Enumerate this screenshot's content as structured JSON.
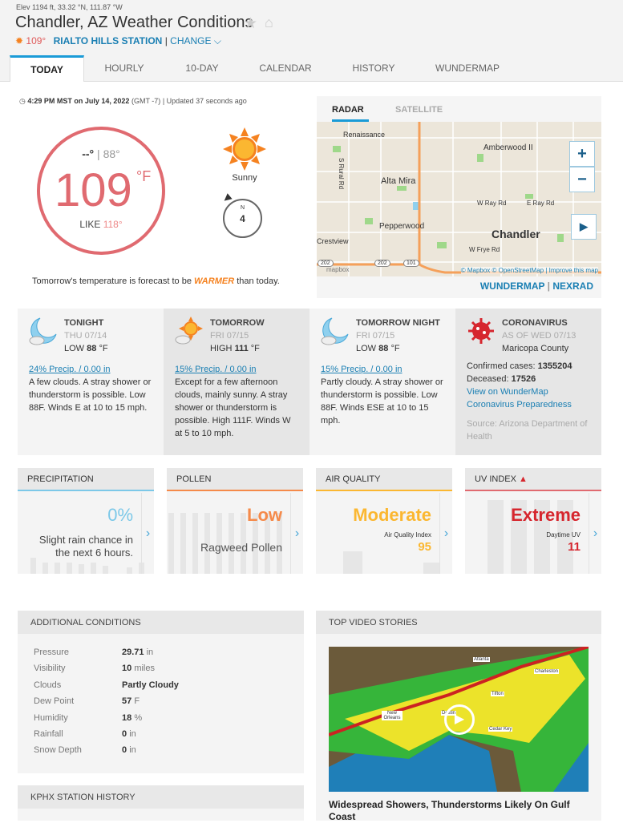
{
  "header": {
    "elevation": "Elev 1194 ft, 33.32 °N, 111.87 °W",
    "title": "Chandler, AZ Weather Conditions",
    "station_temp": "109°",
    "station_name": "RIALTO HILLS STATION",
    "separator": "|",
    "change": "CHANGE"
  },
  "tabs": [
    "TODAY",
    "HOURLY",
    "10-DAY",
    "CALENDAR",
    "HISTORY",
    "WUNDERMAP"
  ],
  "current": {
    "time": "4:29 PM MST on July 14, 2022",
    "tz": "(GMT -7)",
    "updated": "| Updated 37 seconds ago",
    "high": "--°",
    "low": "88°",
    "temp": "109",
    "unit": "°F",
    "like_label": "LIKE",
    "like": "118°",
    "condition": "Sunny",
    "wind_dir": "N",
    "wind_speed": "4",
    "tomorrow_pre": "Tomorrow's temperature is forecast to be",
    "tomorrow_word": "WARMER",
    "tomorrow_post": "than today."
  },
  "map": {
    "tabs": [
      "RADAR",
      "SATELLITE"
    ],
    "labels": [
      "Renaissance",
      "Amberwood II",
      "S Rural Rd",
      "Alta Mira",
      "W Ray Rd",
      "E Ray Rd",
      "Pepperwood",
      "Chandler",
      "Crestview",
      "W Frye Rd",
      "202",
      "202",
      "101"
    ],
    "attribution": "© Mapbox © OpenStreetMap | Improve this map",
    "logo": "mapbox",
    "links": {
      "wundermap": "WUNDERMAP",
      "sep": "|",
      "nexrad": "NEXRAD"
    }
  },
  "forecast": [
    {
      "title": "TONIGHT",
      "date": "THU 07/14",
      "temp_label": "LOW",
      "temp": "88",
      "unit": "°F",
      "precip": "24% Precip. / 0.00 in",
      "text": "A few clouds. A stray shower or thunderstorm is possible. Low 88F. Winds E at 10 to 15 mph.",
      "icon": "moon-cloud-icon"
    },
    {
      "title": "TOMORROW",
      "date": "FRI 07/15",
      "temp_label": "HIGH",
      "temp": "111",
      "unit": "°F",
      "precip": "15% Precip. / 0.00 in",
      "text": "Except for a few afternoon clouds, mainly sunny. A stray shower or thunderstorm is possible. High 111F. Winds W at 5 to 10 mph.",
      "icon": "sun-cloud-icon"
    },
    {
      "title": "TOMORROW NIGHT",
      "date": "FRI 07/15",
      "temp_label": "LOW",
      "temp": "88",
      "unit": "°F",
      "precip": "15% Precip. / 0.00 in",
      "text": "Partly cloudy. A stray shower or thunderstorm is possible. Low 88F. Winds ESE at 10 to 15 mph.",
      "icon": "moon-cloud-icon"
    }
  ],
  "covid": {
    "title": "CORONAVIRUS",
    "date": "AS OF WED 07/13",
    "county": "Maricopa County",
    "cases_label": "Confirmed cases:",
    "cases": "1355204",
    "deceased_label": "Deceased:",
    "deceased": "17526",
    "link1": "View on WunderMap",
    "link2": "Coronavirus Preparedness",
    "source": "Source: Arizona Department of Health"
  },
  "tiles": [
    {
      "title": "PRECIPITATION",
      "value": "0%",
      "desc": "Slight rain chance in the next 6 hours.",
      "color": "#7cc8e8"
    },
    {
      "title": "POLLEN",
      "value": "Low",
      "desc": "Ragweed Pollen",
      "color": "#f58a4a"
    },
    {
      "title": "AIR QUALITY",
      "value": "Moderate",
      "sub": "Air Quality Index",
      "num": "95",
      "color": "#fbb731"
    },
    {
      "title": "UV INDEX",
      "warn": "▲",
      "value": "Extreme",
      "sub": "Daytime UV",
      "num": "11",
      "color": "#e02b35"
    }
  ],
  "additional": {
    "title": "ADDITIONAL CONDITIONS",
    "rows": [
      {
        "label": "Pressure",
        "value": "29.71",
        "unit": "in"
      },
      {
        "label": "Visibility",
        "value": "10",
        "unit": "miles"
      },
      {
        "label": "Clouds",
        "value": "Partly Cloudy",
        "unit": ""
      },
      {
        "label": "Dew Point",
        "value": "57",
        "unit": "F"
      },
      {
        "label": "Humidity",
        "value": "18",
        "unit": "%"
      },
      {
        "label": "Rainfall",
        "value": "0",
        "unit": "in"
      },
      {
        "label": "Snow Depth",
        "value": "0",
        "unit": "in"
      }
    ]
  },
  "station_history": {
    "title": "KPHX STATION HISTORY"
  },
  "video": {
    "title": "TOP VIDEO STORIES",
    "cities": [
      "Atlanta",
      "Charleston",
      "Tifton",
      "New Orleans",
      "Destin",
      "Cedar Key"
    ],
    "caption": "Widespread Showers, Thunderstorms Likely On Gulf Coast"
  }
}
